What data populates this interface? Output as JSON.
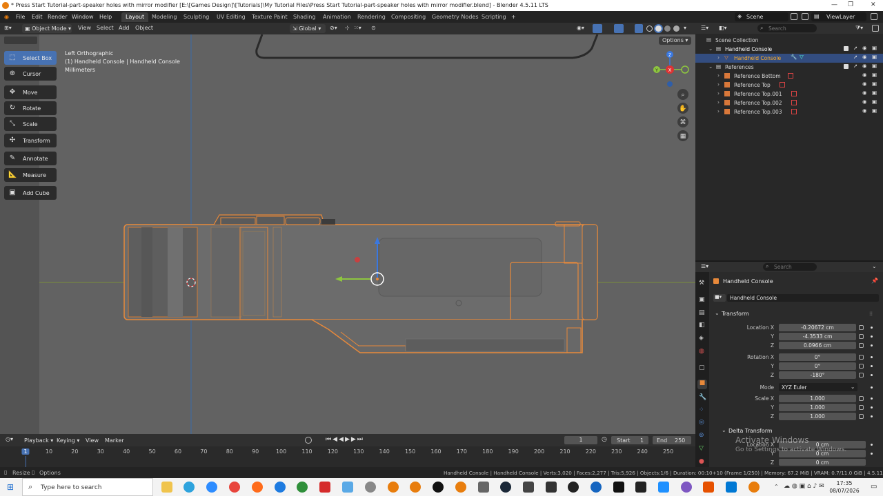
{
  "window": {
    "title": "* Press Start Tutorial-part-speaker holes with mirror modifier [E:\\[Games Design]\\[Tutorials]\\My Tutorial Files\\Press Start Tutorial-part-speaker holes with mirror modifier.blend] - Blender 4.5.11 LTS"
  },
  "menu": [
    "File",
    "Edit",
    "Render",
    "Window",
    "Help"
  ],
  "workspaces": [
    {
      "label": "Layout",
      "active": true
    },
    {
      "label": "Modeling"
    },
    {
      "label": "Sculpting"
    },
    {
      "label": "UV Editing"
    },
    {
      "label": "Texture Paint"
    },
    {
      "label": "Shading"
    },
    {
      "label": "Animation"
    },
    {
      "label": "Rendering"
    },
    {
      "label": "Compositing"
    },
    {
      "label": "Geometry Nodes"
    },
    {
      "label": "Scripting"
    }
  ],
  "workspace_add": "+",
  "scene": "Scene",
  "view_layer": "ViewLayer",
  "viewport_header": {
    "mode": "Object Mode",
    "menus": [
      "View",
      "Select",
      "Add",
      "Object"
    ],
    "orientation": "Global",
    "options": "Options"
  },
  "viewport_overlay": {
    "view": "Left Orthographic",
    "object": "(1) Handheld Console | Handheld Console",
    "units": "Millimeters"
  },
  "tools": [
    {
      "label": "Select Box",
      "icon": "select-box-icon",
      "active": true
    },
    {
      "label": "Cursor",
      "icon": "cursor-icon"
    },
    {
      "label": "Move",
      "icon": "move-icon"
    },
    {
      "label": "Rotate",
      "icon": "rotate-icon"
    },
    {
      "label": "Scale",
      "icon": "scale-icon"
    },
    {
      "label": "Transform",
      "icon": "transform-icon"
    },
    {
      "label": "Annotate",
      "icon": "annotate-icon"
    },
    {
      "label": "Measure",
      "icon": "measure-icon"
    },
    {
      "label": "Add Cube",
      "icon": "add-cube-icon"
    }
  ],
  "gizmo": {
    "z": "Z",
    "x": "X",
    "y": "Y"
  },
  "outliner": {
    "search_placeholder": "Search",
    "items": [
      {
        "label": "Scene Collection",
        "indent": 0
      },
      {
        "label": "Handheld Console",
        "indent": 1,
        "bold": true
      },
      {
        "label": "Handheld Console",
        "indent": 2,
        "selected": true
      },
      {
        "label": "References",
        "indent": 1
      },
      {
        "label": "Reference Bottom",
        "indent": 2
      },
      {
        "label": "Reference Top",
        "indent": 2
      },
      {
        "label": "Reference Top.001",
        "indent": 2
      },
      {
        "label": "Reference Top.002",
        "indent": 2
      },
      {
        "label": "Reference Top.003",
        "indent": 2
      }
    ]
  },
  "properties": {
    "search_placeholder": "Search",
    "object_name": "Handheld Console",
    "object_field": "Handheld Console",
    "transform_label": "Transform",
    "location_label": "Location X",
    "location": [
      "-0.20672 cm",
      "-4.3533 cm",
      "0.0966 cm"
    ],
    "rotation_label": "Rotation X",
    "rotation": [
      "0°",
      "0°",
      "-180°"
    ],
    "mode_label": "Mode",
    "mode_value": "XYZ Euler",
    "scale_label": "Scale X",
    "scale": [
      "1.000",
      "1.000",
      "1.000"
    ],
    "axis_y": "Y",
    "axis_z": "Z",
    "delta_label": "Delta Transform",
    "delta_location_label": "Location X",
    "delta_location": [
      "0 cm",
      "0 cm",
      "0 cm"
    ]
  },
  "watermark": {
    "line1": "Activate Windows",
    "line2": "Go to Settings to activate Windows."
  },
  "timeline": {
    "menus": [
      "Playback",
      "Keying",
      "View",
      "Marker"
    ],
    "current_frame": "1",
    "start_label": "Start",
    "start": "1",
    "end_label": "End",
    "end": "250",
    "ruler": [
      "1",
      "10",
      "20",
      "30",
      "40",
      "50",
      "60",
      "70",
      "80",
      "90",
      "100",
      "110",
      "120",
      "130",
      "140",
      "150",
      "160",
      "170",
      "180",
      "190",
      "200",
      "210",
      "220",
      "230",
      "240",
      "250"
    ]
  },
  "statusbar": {
    "left1": "Resize",
    "left2": "Options",
    "stats": "Handheld Console | Handheld Console | Verts:3,020 | Faces:2,277 | Tris:5,926 | Objects:1/6 | Duration: 00:10+10 (Frame 1/250) | Memory: 67.2 MiB | VRAM: 0.7/11.0 GiB | 4.5.11"
  },
  "taskbar": {
    "search_placeholder": "Type here to search",
    "time": "17:35",
    "date": "08/07/2026"
  },
  "colors": {
    "accent": "#4772b3",
    "selection": "#e8893a",
    "viewport_bg": "#626262",
    "panel": "#282828"
  }
}
